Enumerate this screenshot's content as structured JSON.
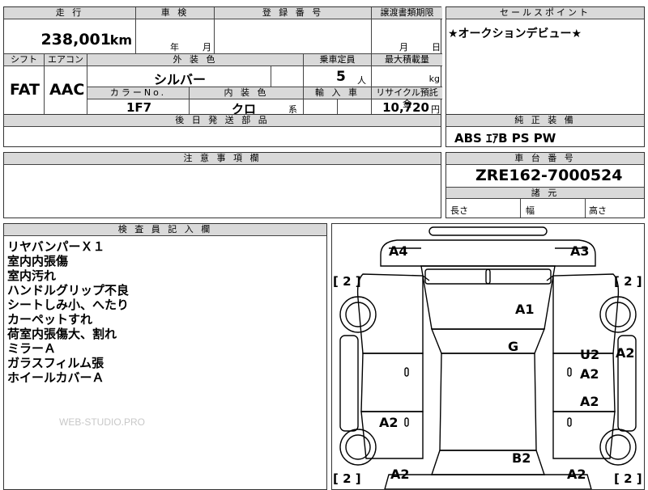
{
  "header": {
    "mileage_label": "走 行",
    "inspection_label": "車 検",
    "registration_label": "登 録 番 号",
    "transfer_label": "譲渡書類期限",
    "sales_point_label": "セールスポイント",
    "mileage_value": "238,001",
    "mileage_unit": "km",
    "year_unit": "年",
    "month_unit": "月",
    "month_unit2": "月",
    "day_unit": "日",
    "sales_point_value": "★オークションデビュー★"
  },
  "specs": {
    "shift_label": "シフト",
    "aircon_label": "エアコン",
    "exterior_label": "外 装 色",
    "capacity_label": "乗車定員",
    "max_load_label": "最大積載量",
    "shift_value": "FAT",
    "aircon_value": "AAC",
    "exterior_value": "シルバー",
    "capacity_value": "5",
    "capacity_unit": "人",
    "load_unit": "kg",
    "color_no_label": "カラーNo.",
    "interior_label": "内 装 色",
    "import_label": "輸 入 車",
    "recycle_label": "リサイクル預託金",
    "color_no_value": "1F7",
    "interior_value": "クロ",
    "interior_unit": "系",
    "recycle_value": "10,720",
    "recycle_unit": "円",
    "later_parts_label": "後 日 発 送 部 品"
  },
  "equipment": {
    "label": "純 正 装 備",
    "value": "ABS ｴｱB PS PW"
  },
  "notes": {
    "label": "注 意 事 項 欄"
  },
  "chassis": {
    "label": "車 台 番 号",
    "value": "ZRE162-7000524",
    "dims_label": "諸 元",
    "length_label": "長さ",
    "width_label": "幅",
    "height_label": "高さ"
  },
  "inspector": {
    "label": "検 査 員 記 入 欄",
    "lines": [
      "リヤバンパーＸ１",
      "室内内張傷",
      "室内汚れ",
      "ハンドルグリップ不良",
      "シートしみ小、へたり",
      "カーペットすれ",
      "荷室内張傷大、割れ",
      "ミラーＡ",
      "ガラスフィルム張",
      "ホイールカバーＡ"
    ],
    "watermark": "WEB-STUDIO.PRO"
  },
  "diagram": {
    "a4": "A4",
    "a3": "A3",
    "a1": "A1",
    "g": "G",
    "u2": "U2",
    "a2_right_mid": "A2",
    "a2_right_edge": "A2",
    "a2_right_lower": "A2",
    "a2_left_lower": "A2",
    "b2": "B2",
    "a2_bottom_left": "A2",
    "a2_bottom_right": "A2",
    "bracket_tl": "[ 2 ]",
    "bracket_tr": "[ 2 ]",
    "bracket_bl": "[ 2 ]",
    "bracket_br": "[ 2 ]"
  }
}
